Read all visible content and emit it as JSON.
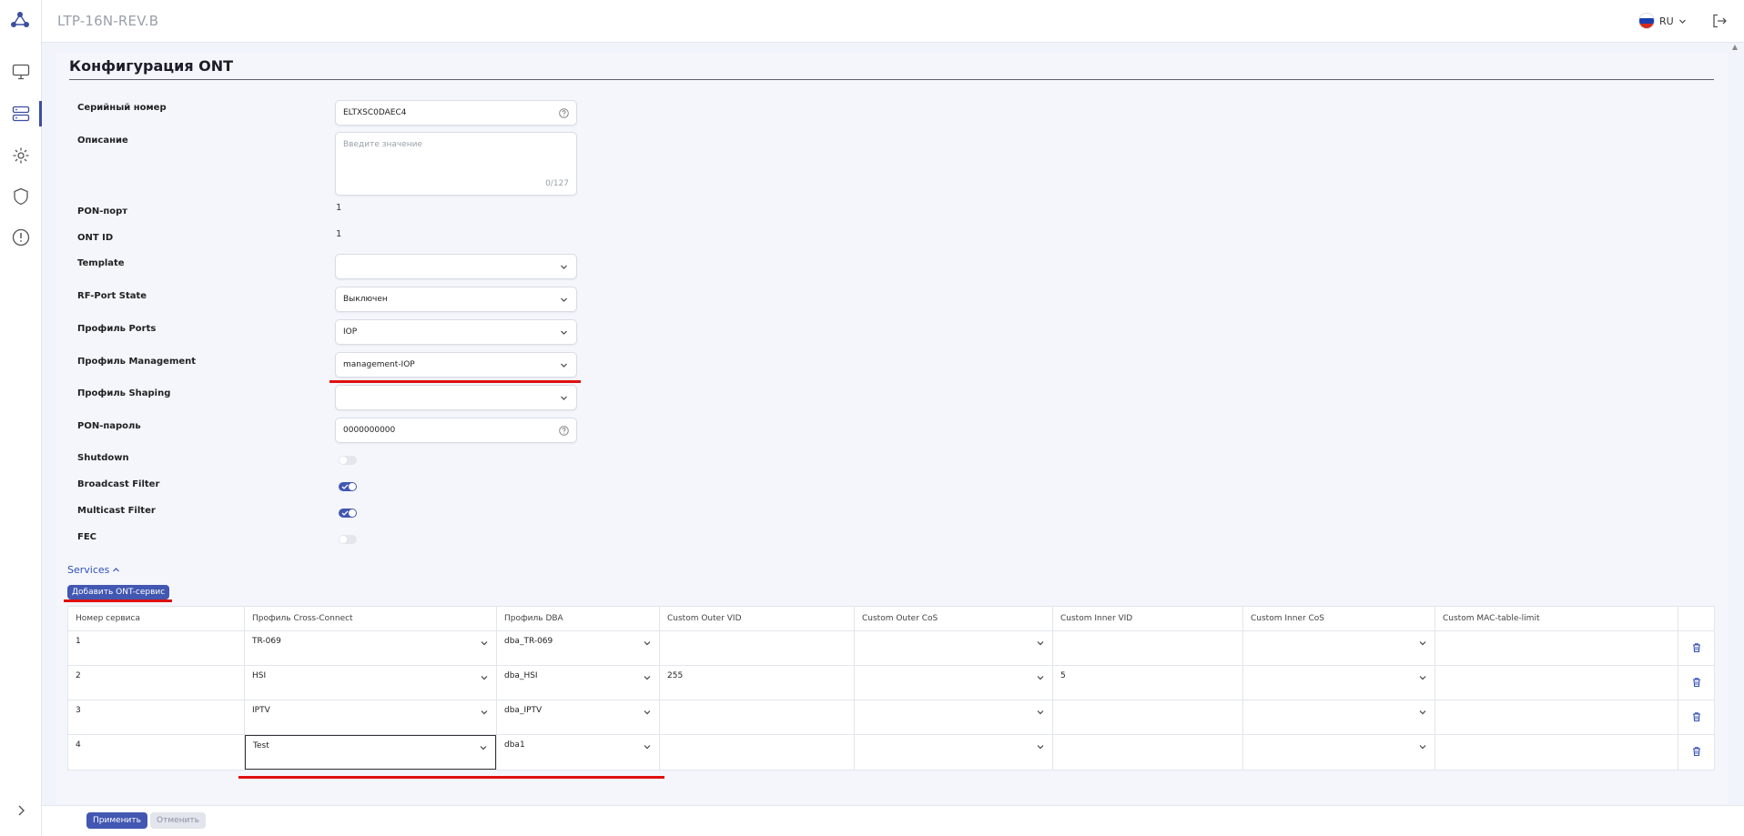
{
  "header": {
    "title": "LTP-16N-REV.B",
    "lang": "RU"
  },
  "page": {
    "title": "Конфигурация ONT"
  },
  "form": {
    "serial": {
      "label": "Серийный номер",
      "value": "ELTXSC0DAEC4"
    },
    "description": {
      "label": "Описание",
      "placeholder": "Введите значение",
      "counter": "0/127"
    },
    "pon_port": {
      "label": "PON-порт",
      "value": "1"
    },
    "ont_id": {
      "label": "ONT ID",
      "value": "1"
    },
    "template": {
      "label": "Template",
      "value": ""
    },
    "rf_port": {
      "label": "RF-Port State",
      "value": "Выключен"
    },
    "ports_profile": {
      "label": "Профиль Ports",
      "value": "IOP"
    },
    "mgmt_profile": {
      "label": "Профиль Management",
      "value": "management-IOP"
    },
    "shaping_profile": {
      "label": "Профиль Shaping",
      "value": ""
    },
    "pon_password": {
      "label": "PON-пароль",
      "value": "0000000000"
    },
    "shutdown": {
      "label": "Shutdown",
      "on": false
    },
    "broadcast": {
      "label": "Broadcast Filter",
      "on": true
    },
    "multicast": {
      "label": "Multicast Filter",
      "on": true
    },
    "fec": {
      "label": "FEC",
      "on": false
    }
  },
  "services": {
    "toggle_label": "Services",
    "add_label": "Добавить ONT-сервис",
    "columns": [
      "Номер сервиса",
      "Профиль Cross-Connect",
      "Профиль DBA",
      "Custom Outer VID",
      "Custom Outer CoS",
      "Custom Inner VID",
      "Custom Inner CoS",
      "Custom MAC-table-limit"
    ],
    "rows": [
      {
        "num": "1",
        "cc": "TR-069",
        "dba": "dba_TR-069",
        "outer_vid": "",
        "outer_cos": "",
        "inner_vid": "",
        "inner_cos": "",
        "mac_limit": ""
      },
      {
        "num": "2",
        "cc": "HSI",
        "dba": "dba_HSI",
        "outer_vid": "255",
        "outer_cos": "",
        "inner_vid": "5",
        "inner_cos": "",
        "mac_limit": ""
      },
      {
        "num": "3",
        "cc": "IPTV",
        "dba": "dba_IPTV",
        "outer_vid": "",
        "outer_cos": "",
        "inner_vid": "",
        "inner_cos": "",
        "mac_limit": ""
      },
      {
        "num": "4",
        "cc": "Test",
        "dba": "dba1",
        "outer_vid": "",
        "outer_cos": "",
        "inner_vid": "",
        "inner_cos": "",
        "mac_limit": ""
      }
    ]
  },
  "footer": {
    "apply": "Применить",
    "cancel": "Отменить"
  },
  "colors": {
    "accent": "#4257b2",
    "highlight": "#e01010",
    "link": "#3450b5"
  }
}
